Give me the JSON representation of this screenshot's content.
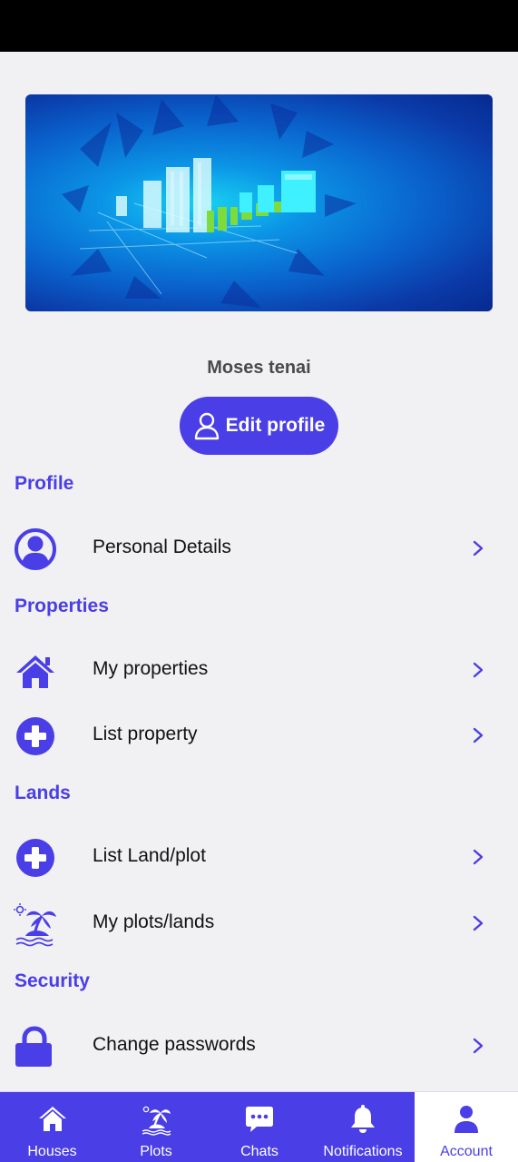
{
  "profile_header": {
    "name": "Moses tenai",
    "edit_button": "Edit profile"
  },
  "sections": {
    "profile": {
      "title": "Profile",
      "items": [
        {
          "label": "Personal Details",
          "icon": "user-circle-icon"
        }
      ]
    },
    "properties": {
      "title": "Properties",
      "items": [
        {
          "label": "My properties",
          "icon": "home-icon"
        },
        {
          "label": "List property",
          "icon": "plus-circle-icon"
        }
      ]
    },
    "lands": {
      "title": "Lands",
      "items": [
        {
          "label": "List Land/plot",
          "icon": "plus-circle-icon"
        },
        {
          "label": "My plots/lands",
          "icon": "island-icon"
        }
      ]
    },
    "security": {
      "title": "Security",
      "items": [
        {
          "label": "Change passwords",
          "icon": "lock-icon"
        }
      ]
    }
  },
  "bottom_nav": [
    {
      "label": "Houses",
      "icon": "home-icon"
    },
    {
      "label": "Plots",
      "icon": "island-icon"
    },
    {
      "label": "Chats",
      "icon": "chat-icon"
    },
    {
      "label": "Notifications",
      "icon": "bell-icon"
    },
    {
      "label": "Account",
      "icon": "user-icon",
      "active": true
    }
  ],
  "colors": {
    "accent": "#4a3ee6",
    "background": "#f1f1f3",
    "text": "#111111"
  }
}
